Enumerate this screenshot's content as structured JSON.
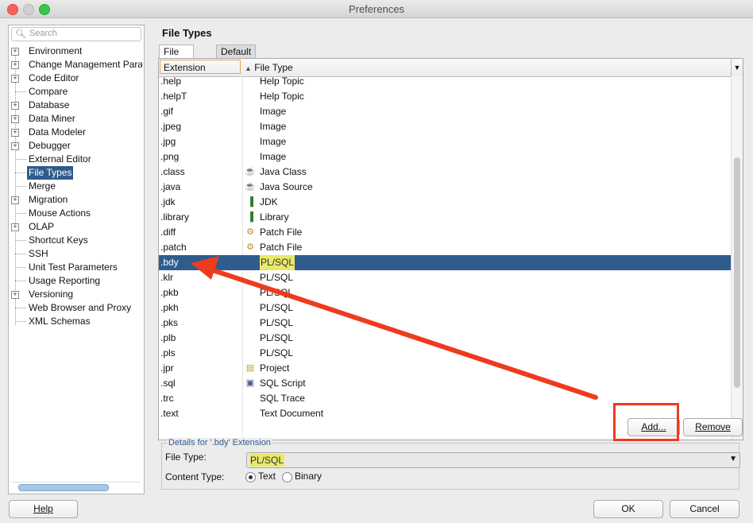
{
  "window": {
    "title": "Preferences"
  },
  "search": {
    "placeholder": "Search"
  },
  "tree": [
    {
      "label": "Environment",
      "expandable": true
    },
    {
      "label": "Change Management Param",
      "expandable": true
    },
    {
      "label": "Code Editor",
      "expandable": true
    },
    {
      "label": "Compare",
      "expandable": false
    },
    {
      "label": "Database",
      "expandable": true
    },
    {
      "label": "Data Miner",
      "expandable": true
    },
    {
      "label": "Data Modeler",
      "expandable": true
    },
    {
      "label": "Debugger",
      "expandable": true
    },
    {
      "label": "External Editor",
      "expandable": false
    },
    {
      "label": "File Types",
      "expandable": false,
      "selected": true
    },
    {
      "label": "Merge",
      "expandable": false
    },
    {
      "label": "Migration",
      "expandable": true
    },
    {
      "label": "Mouse Actions",
      "expandable": false
    },
    {
      "label": "OLAP",
      "expandable": true
    },
    {
      "label": "Shortcut Keys",
      "expandable": false
    },
    {
      "label": "SSH",
      "expandable": false
    },
    {
      "label": "Unit Test Parameters",
      "expandable": false
    },
    {
      "label": "Usage Reporting",
      "expandable": false
    },
    {
      "label": "Versioning",
      "expandable": true
    },
    {
      "label": "Web Browser and Proxy",
      "expandable": false
    },
    {
      "label": "XML Schemas",
      "expandable": false
    }
  ],
  "panel": {
    "title": "File Types",
    "tabs": [
      "File Types",
      "Default Editors"
    ],
    "columns": {
      "extension": "Extension",
      "file_type": "File Type"
    },
    "rows": [
      {
        "ext": ".help",
        "type": "Help Topic",
        "icon": ""
      },
      {
        "ext": ".helpT",
        "type": "Help Topic",
        "icon": ""
      },
      {
        "ext": ".gif",
        "type": "Image",
        "icon": ""
      },
      {
        "ext": ".jpeg",
        "type": "Image",
        "icon": ""
      },
      {
        "ext": ".jpg",
        "type": "Image",
        "icon": ""
      },
      {
        "ext": ".png",
        "type": "Image",
        "icon": ""
      },
      {
        "ext": ".class",
        "type": "Java Class",
        "icon": "java-class-icon"
      },
      {
        "ext": ".java",
        "type": "Java Source",
        "icon": "java-source-icon"
      },
      {
        "ext": ".jdk",
        "type": "JDK",
        "icon": "library-icon"
      },
      {
        "ext": ".library",
        "type": "Library",
        "icon": "library-icon"
      },
      {
        "ext": ".diff",
        "type": "Patch File",
        "icon": "patch-icon"
      },
      {
        "ext": ".patch",
        "type": "Patch File",
        "icon": "patch-icon"
      },
      {
        "ext": ".bdy",
        "type": "PL/SQL",
        "icon": "",
        "selected": true
      },
      {
        "ext": ".klr",
        "type": "PL/SQL",
        "icon": ""
      },
      {
        "ext": ".pkb",
        "type": "PL/SQL",
        "icon": ""
      },
      {
        "ext": ".pkh",
        "type": "PL/SQL",
        "icon": ""
      },
      {
        "ext": ".pks",
        "type": "PL/SQL",
        "icon": ""
      },
      {
        "ext": ".plb",
        "type": "PL/SQL",
        "icon": ""
      },
      {
        "ext": ".pls",
        "type": "PL/SQL",
        "icon": ""
      },
      {
        "ext": ".jpr",
        "type": "Project",
        "icon": "project-icon"
      },
      {
        "ext": ".sql",
        "type": "SQL Script",
        "icon": "sql-script-icon"
      },
      {
        "ext": ".trc",
        "type": "SQL Trace",
        "icon": ""
      },
      {
        "ext": ".text",
        "type": "Text Document",
        "icon": ""
      }
    ],
    "add_label": "Add...",
    "remove_label": "Remove",
    "details": {
      "legend": "Details for '.bdy' Extension",
      "file_type_label": "File Type:",
      "file_type_value": "PL/SQL",
      "content_type_label": "Content Type:",
      "content_options": [
        "Text",
        "Binary"
      ],
      "content_selected": "Text"
    }
  },
  "footer": {
    "help_label": "Help",
    "ok_label": "OK",
    "cancel_label": "Cancel"
  },
  "colors": {
    "selection": "#2f5c8c",
    "annotation": "#ee3b20",
    "highlight": "#e8e86a"
  }
}
